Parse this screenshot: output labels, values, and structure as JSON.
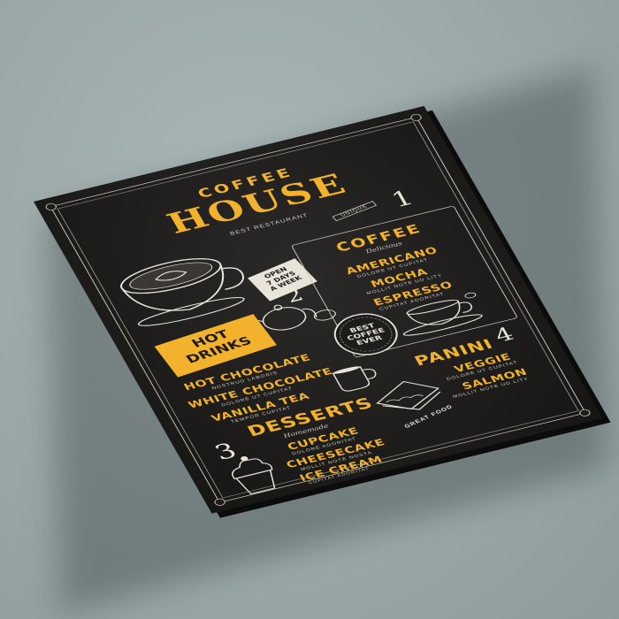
{
  "menu": {
    "title_top": "COFFEE",
    "title_main": "HOUSE",
    "tagline": "BEST RESTAURANT",
    "unique": "UNIQUE",
    "open_sign": [
      "OPEN",
      "7 DAYS",
      "A WEEK"
    ],
    "badge": [
      "BEST",
      "COFFEE",
      "EVER"
    ],
    "sections": {
      "hot_drinks": {
        "number": "2",
        "title_lines": [
          "HOT",
          "DRINKS"
        ],
        "items": [
          {
            "name": "HOT CHOCOLATE",
            "desc": "NOSTRUD LABORIS"
          },
          {
            "name": "WHITE CHOCOLATE",
            "desc": "DOLORE UT CUPITAT"
          },
          {
            "name": "VANILLA TEA",
            "desc": "TEMPOR CUPITAT"
          }
        ]
      },
      "coffee": {
        "number": "1",
        "title": "COFFEE",
        "subtitle": "Delicious",
        "items": [
          {
            "name": "AMERICANO",
            "desc": "DOLORE UT CUPITAT"
          },
          {
            "name": "MOCHA",
            "desc": "MOLLIT NOTE UD LITY"
          },
          {
            "name": "ESPRESSO",
            "desc": "CUPITAT ADORITAT"
          }
        ]
      },
      "desserts": {
        "number": "3",
        "title": "DESSERTS",
        "subtitle": "Homemade",
        "items": [
          {
            "name": "CUPCAKE",
            "desc": "DOLORE ADORITAT"
          },
          {
            "name": "CHEESECAKE",
            "desc": "MOLLIT NOTE NOSTA"
          },
          {
            "name": "ICE CREAM",
            "desc": "CUPITAT ADORITAT"
          }
        ]
      },
      "panini": {
        "number": "4",
        "title": "PANINI",
        "items": [
          {
            "name": "VEGGIE",
            "desc": "DOLORE UT CUPITAT"
          },
          {
            "name": "SALMON",
            "desc": "MOLLIT NOTE UD LITY"
          }
        ]
      }
    },
    "great_food": "GREAT FOOD"
  },
  "colors": {
    "board": "#1e1d1c",
    "accent": "#f2b22c",
    "chalk": "#e9e4da",
    "surface": "#9ba8a8"
  }
}
